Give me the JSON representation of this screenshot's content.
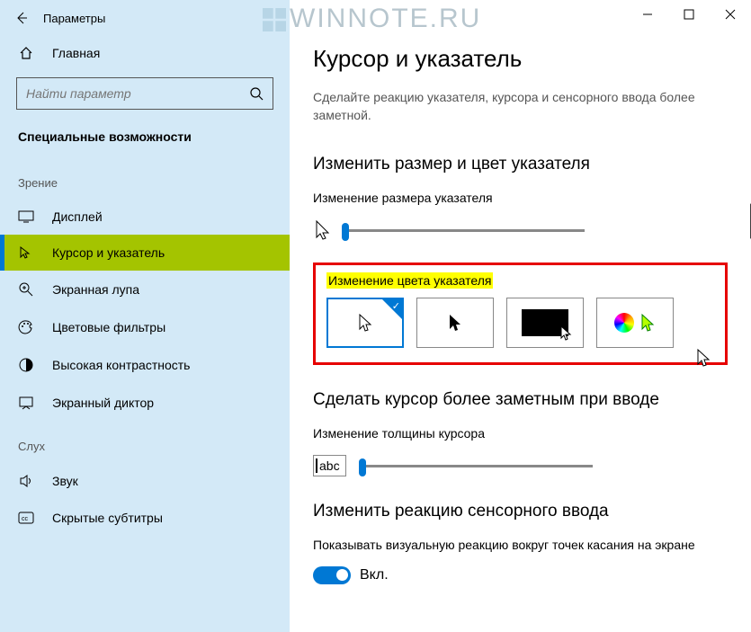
{
  "window": {
    "title": "Параметры"
  },
  "watermark": "WINNOTE.RU",
  "sidebar": {
    "home": "Главная",
    "search_placeholder": "Найти параметр",
    "category": "Специальные возможности",
    "groups": [
      {
        "label": "Зрение",
        "items": [
          {
            "icon": "display",
            "label": "Дисплей"
          },
          {
            "icon": "cursor",
            "label": "Курсор и указатель",
            "selected": true
          },
          {
            "icon": "magnifier",
            "label": "Экранная лупа"
          },
          {
            "icon": "palette",
            "label": "Цветовые фильтры"
          },
          {
            "icon": "contrast",
            "label": "Высокая контрастность"
          },
          {
            "icon": "narrator",
            "label": "Экранный диктор"
          }
        ]
      },
      {
        "label": "Слух",
        "items": [
          {
            "icon": "sound",
            "label": "Звук"
          },
          {
            "icon": "cc",
            "label": "Скрытые субтитры"
          }
        ]
      }
    ]
  },
  "page": {
    "title": "Курсор и указатель",
    "description": "Сделайте реакцию указателя, курсора и сенсорного ввода более заметной.",
    "size_section": "Изменить размер и цвет указателя",
    "size_label": "Изменение размера указателя",
    "color_label": "Изменение цвета указателя",
    "cursor_section": "Сделать курсор более заметным при вводе",
    "thickness_label": "Изменение толщины курсора",
    "abc_text": "abc",
    "touch_section": "Изменить реакцию сенсорного ввода",
    "touch_desc": "Показывать визуальную реакцию вокруг точек касания на экране",
    "toggle_on": "Вкл."
  }
}
